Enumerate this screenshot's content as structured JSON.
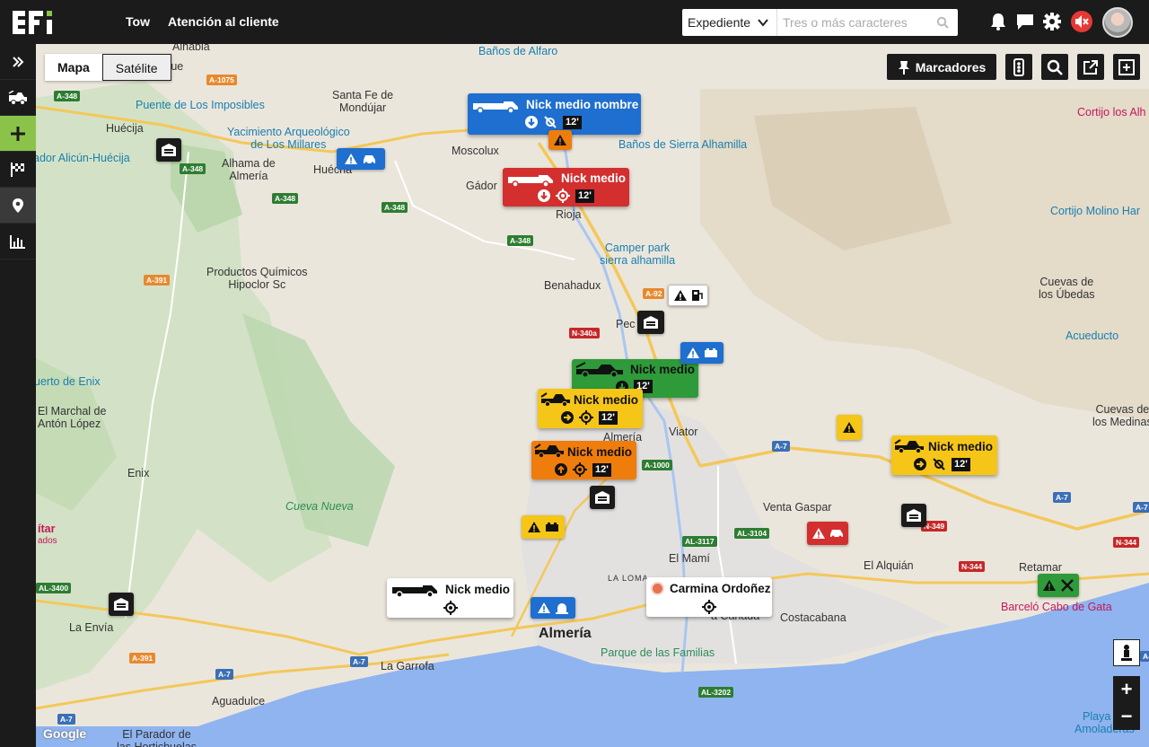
{
  "header": {
    "brand": "EFI",
    "nav": [
      "Tow",
      "Atención al cliente"
    ],
    "search": {
      "select_value": "Expediente",
      "placeholder": "Tres o más caracteres"
    },
    "icons": [
      "bell-icon",
      "chat-icon",
      "gear-icon",
      "mute-icon"
    ]
  },
  "sidebar": {
    "items": [
      "expand-icon",
      "tow-truck-icon",
      "add-icon",
      "finish-flag-icon",
      "location-pin-icon",
      "stats-icon"
    ]
  },
  "map": {
    "type_buttons": {
      "map": "Mapa",
      "satellite": "Satélite"
    },
    "tools": {
      "markers": "Marcadores"
    },
    "zoom_in": "+",
    "zoom_out": "−",
    "attribution": "Google",
    "labels": {
      "almeria": "Almería",
      "santa_fe": "Santa Fe de\nMondújar",
      "huecija": "Huécija",
      "banos_alfaro": "Baños de Alfaro",
      "puente": "Puente de Los Imposibles",
      "alicun": "ador Alicún-Huécija",
      "alhama": "Alhama de\nAlmería",
      "huecha": "Huécha",
      "yacimiento": "Yacimiento Arqueológico\nde Los Millares",
      "moscolux": "Moscolux",
      "gador": "Gádor",
      "rioja": "Rioja",
      "banos_sierra": "Baños de Sierra Alhamilla",
      "cortijo_alh": "Cortijo los Alh",
      "cortijo_molino": "Cortijo Molino Har",
      "camper": "Camper park\nsierra alhamilla",
      "productos": "Productos Químicos\nHipoclor Sc",
      "benahadux": "Benahadux",
      "cuevas_ubedas": "Cuevas de\nlos Úbedas",
      "pechina": "Pec",
      "acueducto": "Acueducto",
      "enix_puerto": "uerto de Enix",
      "marchal": "El Marchal de\nAntón López",
      "viator": "Viator",
      "almeria_town": "Almería",
      "cuevas_medinas": "Cuevas de\nlos Medinas",
      "enix": "Enix",
      "cueva_nueva": "Cueva Nueva",
      "venta_gaspar": "Venta Gaspar",
      "el_mami": "El Mamí",
      "el_alquian": "El Alquián",
      "retamar": "Retamar",
      "barcelo": "Barceló Cabo de Gata",
      "la_loma": "LA LOMA",
      "costacabana": "Costacabana",
      "canada": "a Cañada",
      "parque": "Parque de las Familias",
      "la_envia": "La Envía",
      "la_garrofa": "La Garrofa",
      "aguadulce": "Aguadulce",
      "parador": "El Parador de\nlas Hortichuelas",
      "playa": "Playa de\nAmoladeras",
      "aitar": "ítar",
      "ados": "ados",
      "alhabia": "Alhabia",
      "terque": "Terque"
    },
    "roads": [
      "A-348",
      "A-1075",
      "A-348",
      "A-348",
      "A-348",
      "A-348",
      "A-391",
      "A-92",
      "N-340a",
      "A-1000",
      "A-7",
      "A-7",
      "AL-3117",
      "AL-3104",
      "N-349",
      "N-344",
      "N-344",
      "A-7",
      "AL-3400",
      "A-391",
      "A-7",
      "A-7",
      "AL-3202",
      "A-7",
      "A-7"
    ],
    "vehicle_cards": [
      {
        "title": "Nick medio nombre",
        "badge": "12'",
        "color": "#1e6fcf"
      },
      {
        "title": "Nick medio",
        "badge": "12'",
        "color": "#d32f2f"
      },
      {
        "title": "Nick medio",
        "badge": "12'",
        "color": "#2e9a3a"
      },
      {
        "title": "Nick medio",
        "badge": "12'",
        "color": "#f5c518"
      },
      {
        "title": "Nick medio",
        "badge": "12'",
        "color": "#ef7d0c"
      },
      {
        "title": "Nick medio",
        "badge": "12'",
        "color": "#f5c518"
      },
      {
        "title": "Nick medio",
        "badge": "",
        "color": "#ffffff"
      },
      {
        "title": "Carmina Ordoñez",
        "badge": "",
        "color": "#ffffff"
      }
    ]
  }
}
